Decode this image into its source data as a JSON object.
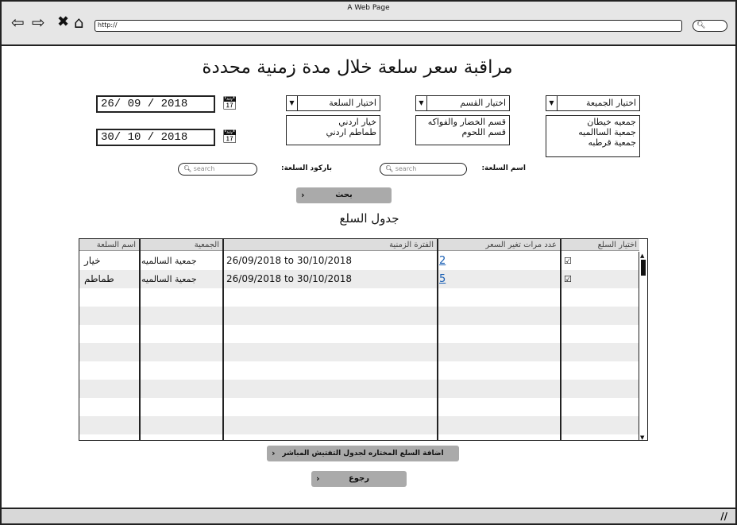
{
  "browser": {
    "window_title": "A Web Page",
    "url": "http://",
    "search_icon": "search-icon"
  },
  "page": {
    "title": "مراقبة سعر سلعة خلال مدة زمنية محددة",
    "date_from": "26/ 09 /   2018",
    "date_to": "30/ 10 /   2018",
    "store_select": {
      "label": "اختيار الجميعة",
      "options": [
        "جمعيه خيطان",
        "جمعية الساالميه",
        "جمعية قرطبه"
      ]
    },
    "section_select": {
      "label": "اختيار القسم",
      "options": [
        "قسم الخضار والفواكه",
        "قسم اللحوم"
      ]
    },
    "item_select": {
      "label": "اختيار السلعة",
      "options": [
        "خيار اردني",
        "طماطم اردني"
      ]
    },
    "item_name_label": "اسم السلعة:",
    "item_name_placeholder": "search",
    "barcode_label": "باركود السلعة:",
    "barcode_placeholder": "search",
    "search_button": "بحث",
    "table_title": "جدول السلع",
    "table": {
      "headers": [
        "اختيار السلع",
        "عدد مرات تغير السعر",
        "الفترة الزمنية",
        "الجمعية",
        "اسم السلعة"
      ],
      "rows": [
        {
          "checked": "☑",
          "changes": "2",
          "period": "26/09/2018 to 30/10/2018",
          "store": "جمعية السالميه",
          "name": "خيار"
        },
        {
          "checked": "☑",
          "changes": "5",
          "period": "26/09/2018 to 30/10/2018",
          "store": "جمعية السالميه",
          "name": "طماطم"
        }
      ]
    },
    "add_button": "اضافة السلع المختاره لجدول التفتيش المباشر",
    "back_button": "رجوع"
  }
}
